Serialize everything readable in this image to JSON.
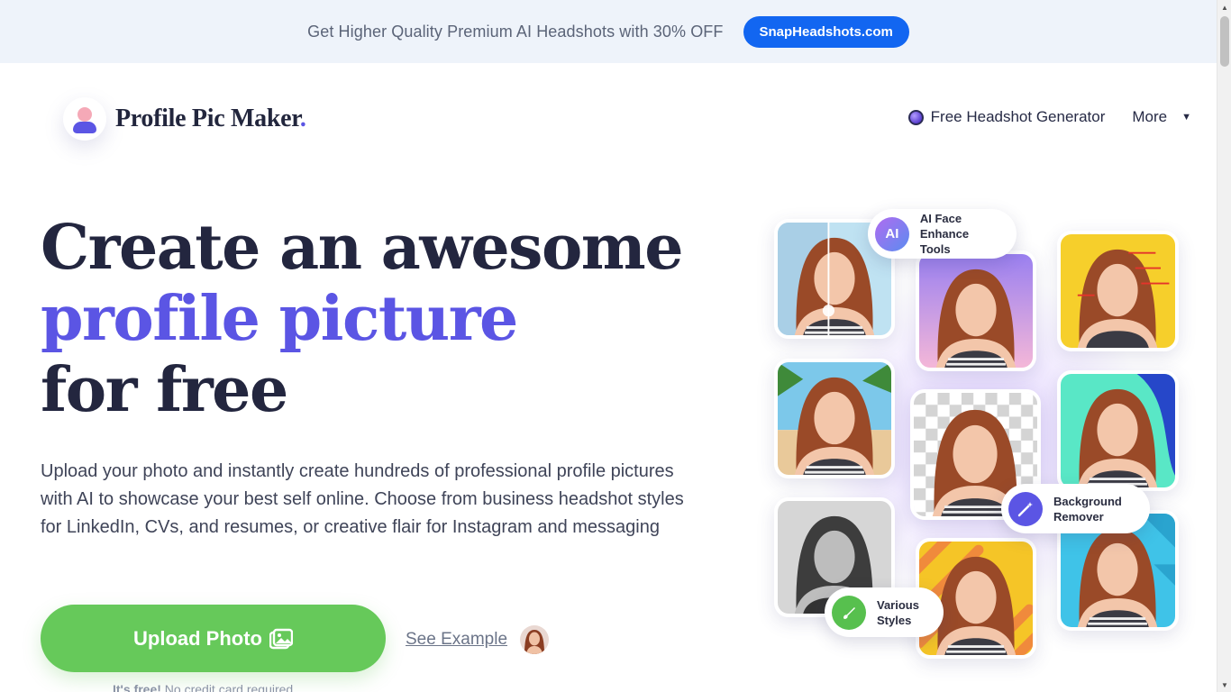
{
  "promo": {
    "text": "Get Higher Quality Premium AI Headshots with 30% OFF",
    "button": "SnapHeadshots.com"
  },
  "header": {
    "logo_text": "Profile Pic Maker",
    "logo_dot": ".",
    "nav": {
      "headshot_generator": "Free Headshot Generator",
      "more": "More",
      "more_caret": "▼"
    }
  },
  "hero": {
    "title_line1": "Create an awesome",
    "title_line2": "profile picture",
    "title_line3": "for free",
    "description": "Upload your photo and instantly create hundreds of professional profile pictures with AI to showcase your best self online. Choose from business headshot styles for LinkedIn, CVs, and resumes, or creative flair for Instagram and messaging",
    "upload_button": "Upload Photo",
    "see_example": "See Example",
    "free_bold": "It's free!",
    "free_rest": " No credit card required"
  },
  "features": {
    "ai_badge": "AI",
    "ai_face_line1": "AI Face",
    "ai_face_line2": "Enhance Tools",
    "bg_line1": "Background",
    "bg_line2": "Remover",
    "styles_line1": "Various",
    "styles_line2": "Styles"
  },
  "colors": {
    "brand": "#5b55e4",
    "cta_green": "#66c95a",
    "promo_blue": "#1266f1",
    "heading": "#23263f"
  },
  "scrollbar": {
    "up_arrow": "▲",
    "down_arrow": "▼"
  }
}
